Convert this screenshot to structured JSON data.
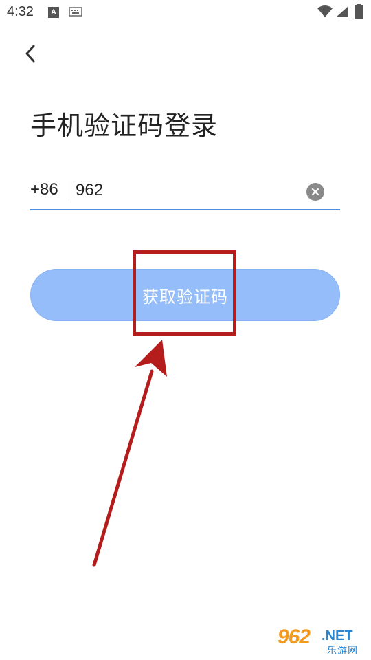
{
  "status_bar": {
    "time": "4:32",
    "a_badge": "A"
  },
  "page": {
    "title": "手机验证码登录"
  },
  "phone_form": {
    "country_code": "+86",
    "phone_value": "962"
  },
  "actions": {
    "get_code_label": "获取验证码"
  },
  "colors": {
    "accent_blue": "#4a90e2",
    "button_fill": "#95bdf9",
    "annotation_red": "#b51d1d"
  },
  "watermark": {
    "number": "962",
    "suffix": ".NET",
    "cn_text": "乐游网"
  }
}
